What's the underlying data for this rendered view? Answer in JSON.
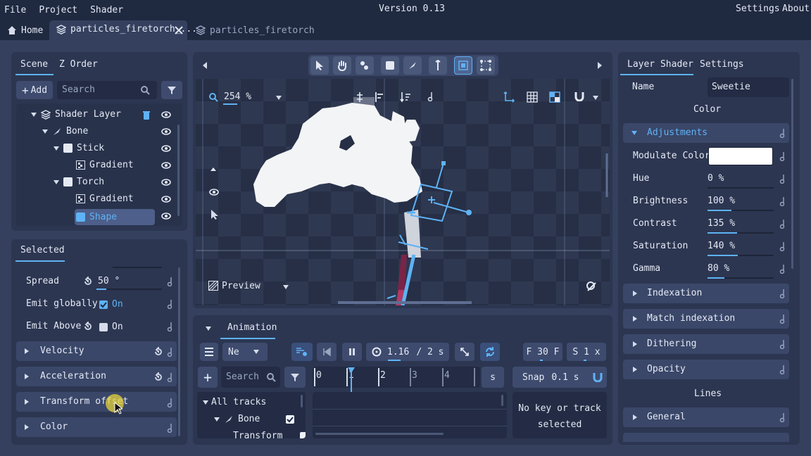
{
  "menu": {
    "file": "File",
    "project": "Project",
    "shader": "Shader",
    "version": "Version 0.13",
    "settings": "Settings",
    "about": "About"
  },
  "tabs": {
    "home": "Home",
    "active": "particles_firetorch_...",
    "other": "particles_firetorch"
  },
  "scene": {
    "tab_scene": "Scene",
    "tab_zorder": "Z Order",
    "add": "Add",
    "search_placeholder": "Search",
    "tree": [
      {
        "label": "Shader Layer"
      },
      {
        "label": "Bone"
      },
      {
        "label": "Stick"
      },
      {
        "label": "Gradient"
      },
      {
        "label": "Torch"
      },
      {
        "label": "Gradient"
      },
      {
        "label": "Shape"
      }
    ]
  },
  "selected": {
    "title": "Selected",
    "spread_label": "Spread",
    "spread_value": "50 °",
    "emit_globally_label": "Emit globally",
    "emit_globally_value": "On",
    "emit_above_label": "Emit Above",
    "emit_above_value": "On",
    "sections": [
      "Velocity",
      "Acceleration",
      "Transform offset",
      "Color"
    ]
  },
  "viewport": {
    "zoom": "254 %",
    "preview": "Preview"
  },
  "animation": {
    "tab": "Animation",
    "mode": "Ne",
    "time": "1.16",
    "duration": "/ 2 s",
    "fps": "F 30 F",
    "speed": "S 1 x",
    "search_placeholder": "Search",
    "ruler": [
      "0",
      "1",
      "2",
      "3",
      "4"
    ],
    "unit": "s",
    "snap_label": "Snap",
    "snap_value": "0.1 s",
    "tracks_header": "All tracks",
    "track_bone": "Bone",
    "track_transform": "Transform",
    "no_key": "No key or track selected"
  },
  "inspector": {
    "tab_shader": "Layer Shader",
    "tab_settings": "Settings",
    "name_label": "Name",
    "name_value": "Sweetie",
    "color_header": "Color",
    "adjustments": "Adjustments",
    "modulate_label": "Modulate Color",
    "modulate_color": "#ffffff",
    "props": [
      {
        "label": "Hue",
        "value": "0 %",
        "fill": 0
      },
      {
        "label": "Brightness",
        "value": "100 %",
        "fill": 0.36
      },
      {
        "label": "Contrast",
        "value": "135 %",
        "fill": 0.45
      },
      {
        "label": "Saturation",
        "value": "140 %",
        "fill": 0.46
      },
      {
        "label": "Gamma",
        "value": "80 %",
        "fill": 0.26
      }
    ],
    "collapsed": [
      "Indexation",
      "Match indexation",
      "Dithering",
      "Opacity"
    ],
    "lines_header": "Lines",
    "general": "General"
  },
  "colors": {
    "accent": "#5fb2f5",
    "bg": "#1f2940",
    "panel": "#34405e"
  }
}
